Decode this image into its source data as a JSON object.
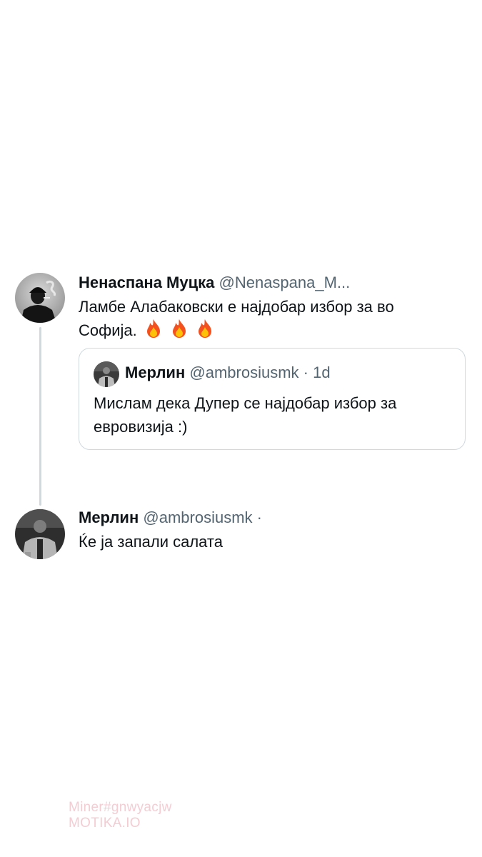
{
  "tweet_main": {
    "display_name": "Ненаспана Муцка",
    "handle": "@Nenaspana_M...",
    "text_line1": "Ламбе Алабаковски е најдобар избор за во",
    "text_line2": "Софија.",
    "emoji": "🔥🔥🔥",
    "avatar_icon": "smoking-man-avatar"
  },
  "quote": {
    "display_name": "Мерлин",
    "handle": "@ambrosiusmk",
    "time": "· 1d",
    "text_line1": "Мислам дека Дупер се најдобар избор за",
    "text_line2": "евровизија :)",
    "avatar_icon": "person-avatar"
  },
  "reply": {
    "display_name": "Мерлин",
    "handle": "@ambrosiusmk ·",
    "text": "Ќе ја запали салата",
    "avatar_icon": "person-avatar"
  },
  "watermark": {
    "line1": "Miner#gnwyacjw",
    "line2": "MOTIKA.IO"
  },
  "colors": {
    "text_primary": "#0f1419",
    "text_secondary": "#536471",
    "border": "#cfd9de",
    "watermark": "#f4cdd3"
  }
}
